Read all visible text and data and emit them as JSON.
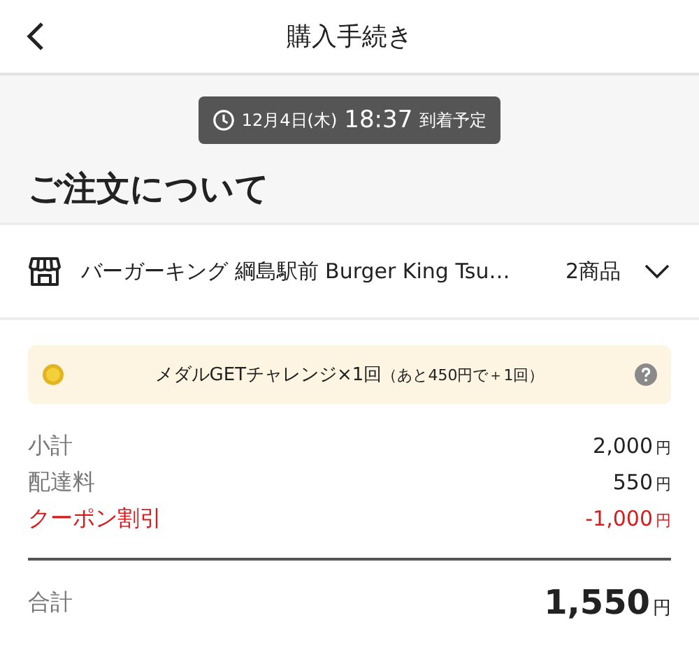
{
  "header": {
    "title": "購入手続き"
  },
  "arrival": {
    "date": "12月4日(木)",
    "time": "18:37",
    "suffix": "到着予定"
  },
  "section_title": "ご注文について",
  "store": {
    "name": "バーガーキング 綱島駅前 Burger King Tsu…",
    "count": "2商品",
    "expanded": false
  },
  "medal": {
    "text": "メダルGETチャレンジ×1回",
    "note": "（あと450円で＋1回）"
  },
  "fees": [
    {
      "label": "小計",
      "amount": "2,000",
      "unit": "円",
      "kind": "normal"
    },
    {
      "label": "配達料",
      "amount": "550",
      "unit": "円",
      "kind": "normal"
    },
    {
      "label": "クーポン割引",
      "amount": "-1,000",
      "unit": "円",
      "kind": "discount"
    }
  ],
  "total": {
    "label": "合計",
    "amount": "1,550",
    "unit": "円"
  }
}
